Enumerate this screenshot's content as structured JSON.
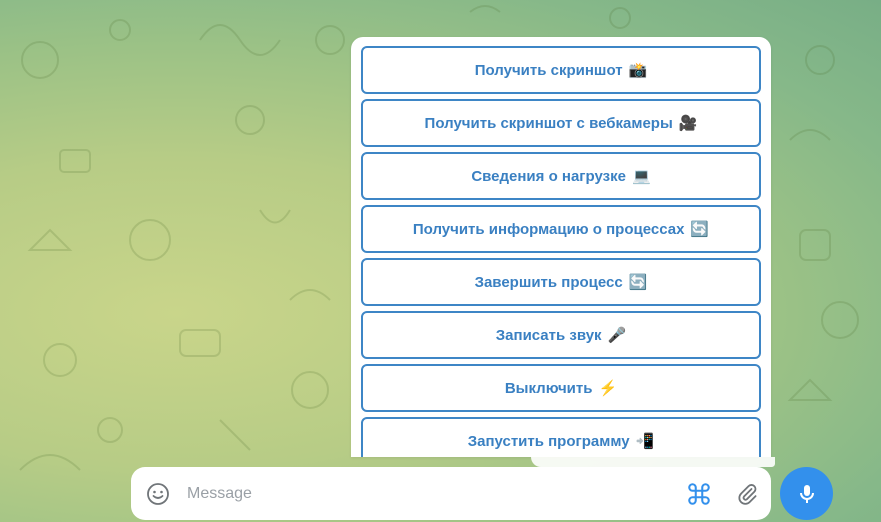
{
  "keyboard": {
    "buttons": [
      {
        "label": "Получить скриншот",
        "emoji": "📸"
      },
      {
        "label": "Получить скриншот с вебкамеры",
        "emoji": "🎥"
      },
      {
        "label": "Сведения о нагрузке",
        "emoji": "💻"
      },
      {
        "label": "Получить информацию о процессах",
        "emoji": "🔄"
      },
      {
        "label": "Завершить процесс",
        "emoji": "🔄"
      },
      {
        "label": "Записать звук",
        "emoji": "🎤"
      },
      {
        "label": "Выключить",
        "emoji": "⚡"
      },
      {
        "label": "Запустить программу",
        "emoji": "📲"
      }
    ]
  },
  "composer": {
    "placeholder": "Message",
    "icons": [
      "smile-icon",
      "command-icon",
      "paperclip-icon",
      "microphone-icon"
    ]
  },
  "colors": {
    "accent": "#3390ec",
    "button_border": "#3e86c6",
    "button_text": "#3a80c2"
  }
}
